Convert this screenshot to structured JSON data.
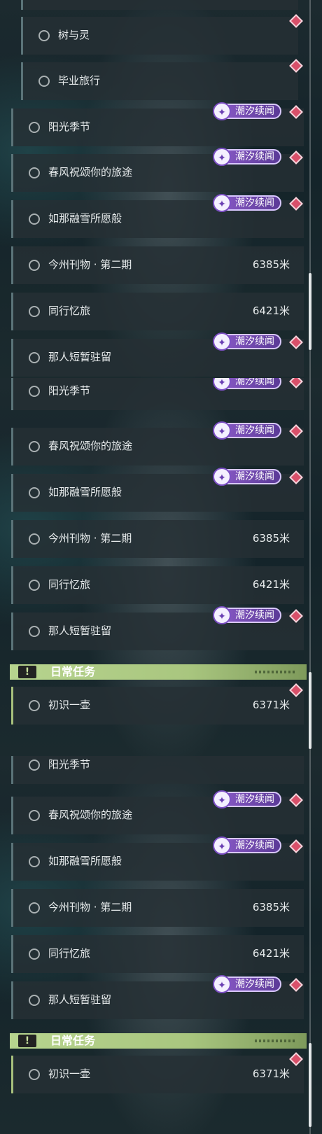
{
  "badge_text": "潮汐续闻",
  "colors": {
    "badge": "#7a4fc0",
    "dot": "#d9506a",
    "daily_header": "#b2cf88",
    "row_bg": "#263034"
  },
  "panel1": {
    "rows": [
      {
        "label": "树与灵",
        "distance": ""
      },
      {
        "label": "毕业旅行",
        "distance": ""
      },
      {
        "label": "阳光季节",
        "distance": ""
      },
      {
        "label": "春风祝颂你的旅途",
        "distance": ""
      },
      {
        "label": "如那融雪所愿般",
        "distance": ""
      },
      {
        "label": "今州刊物 · 第二期",
        "distance": "6385米"
      },
      {
        "label": "同行忆旅",
        "distance": "6421米"
      },
      {
        "label": "那人短暂驻留",
        "distance": ""
      }
    ]
  },
  "panel2": {
    "rows": [
      {
        "label": "阳光季节",
        "distance": ""
      },
      {
        "label": "春风祝颂你的旅途",
        "distance": ""
      },
      {
        "label": "如那融雪所愿般",
        "distance": ""
      },
      {
        "label": "今州刊物 · 第二期",
        "distance": "6385米"
      },
      {
        "label": "同行忆旅",
        "distance": "6421米"
      },
      {
        "label": "那人短暂驻留",
        "distance": ""
      }
    ],
    "section_title": "日常任务",
    "section_icon": "!",
    "daily_rows": [
      {
        "label": "初识一壶",
        "distance": "6371米"
      }
    ]
  },
  "panel3": {
    "rows": [
      {
        "label": "阳光季节",
        "distance": ""
      },
      {
        "label": "春风祝颂你的旅途",
        "distance": ""
      },
      {
        "label": "如那融雪所愿般",
        "distance": ""
      },
      {
        "label": "今州刊物 · 第二期",
        "distance": "6385米"
      },
      {
        "label": "同行忆旅",
        "distance": "6421米"
      },
      {
        "label": "那人短暂驻留",
        "distance": ""
      }
    ],
    "section_title": "日常任务",
    "section_icon": "!",
    "daily_rows": [
      {
        "label": "初识一壶",
        "distance": "6371米"
      }
    ]
  }
}
